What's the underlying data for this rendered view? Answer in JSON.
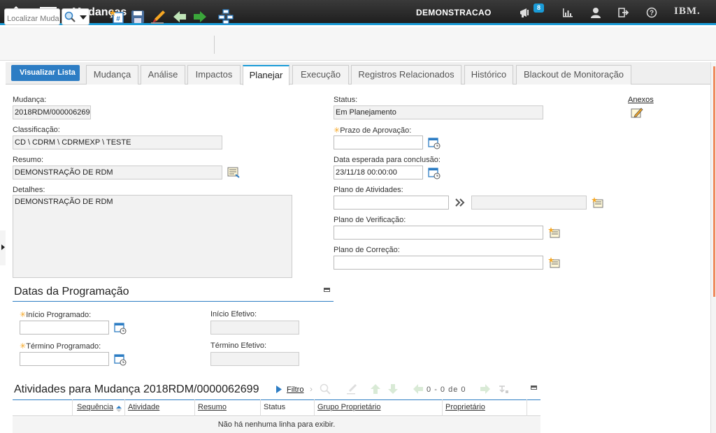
{
  "header": {
    "app_title": "Mudanças",
    "environment": "DEMONSTRACAO",
    "notification_count": "8",
    "brand": "IBM."
  },
  "toolbar": {
    "search_placeholder": "Localizar Mudança"
  },
  "tabs": {
    "back_label": "Visualizar Lista",
    "items": [
      "Mudança",
      "Análise",
      "Impactos",
      "Planejar",
      "Execução",
      "Registros Relacionados",
      "Histórico",
      "Blackout de Monitoração"
    ]
  },
  "form": {
    "mudanca_label": "Mudança:",
    "mudanca_value": "2018RDM/0000062699",
    "classificacao_label": "Classificação:",
    "classificacao_value": "CD \\ CDRM \\ CDRMEXP \\ TESTE",
    "resumo_label": "Resumo:",
    "resumo_value": "DEMONSTRAÇÃO DE RDM",
    "detalhes_label": "Detalhes:",
    "detalhes_value": "DEMONSTRAÇÃO DE RDM",
    "status_label": "Status:",
    "status_value": "Em Planejamento",
    "prazo_label": "Prazo de Aprovação:",
    "prazo_value": "",
    "data_esperada_label": "Data esperada para conclusão:",
    "data_esperada_value": "23/11/18 00:00:00",
    "plano_atividades_label": "Plano de Atividades:",
    "plano_verificacao_label": "Plano de Verificação:",
    "plano_correcao_label": "Plano de Correção:",
    "anexos_label": "Anexos"
  },
  "schedule": {
    "title": "Datas da Programação",
    "inicio_programado_label": "Início Programado:",
    "termino_programado_label": "Término Programado:",
    "inicio_efetivo_label": "Início Efetivo:",
    "termino_efetivo_label": "Término Efetivo:"
  },
  "activities": {
    "title": "Atividades para Mudança 2018RDM/0000062699",
    "filter_label": "Filtro",
    "pager_from": "0",
    "pager_dash": "-",
    "pager_to": "0",
    "pager_of": "de",
    "pager_total": "0",
    "columns": [
      "Sequência",
      "Atividade",
      "Resumo",
      "Status",
      "Grupo Proprietário",
      "Proprietário"
    ],
    "empty_message": "Não há nenhuma linha para exibir."
  },
  "colors": {
    "accent": "#1a9bd7",
    "button_blue": "#2d7dc4",
    "required": "#f5a623"
  }
}
